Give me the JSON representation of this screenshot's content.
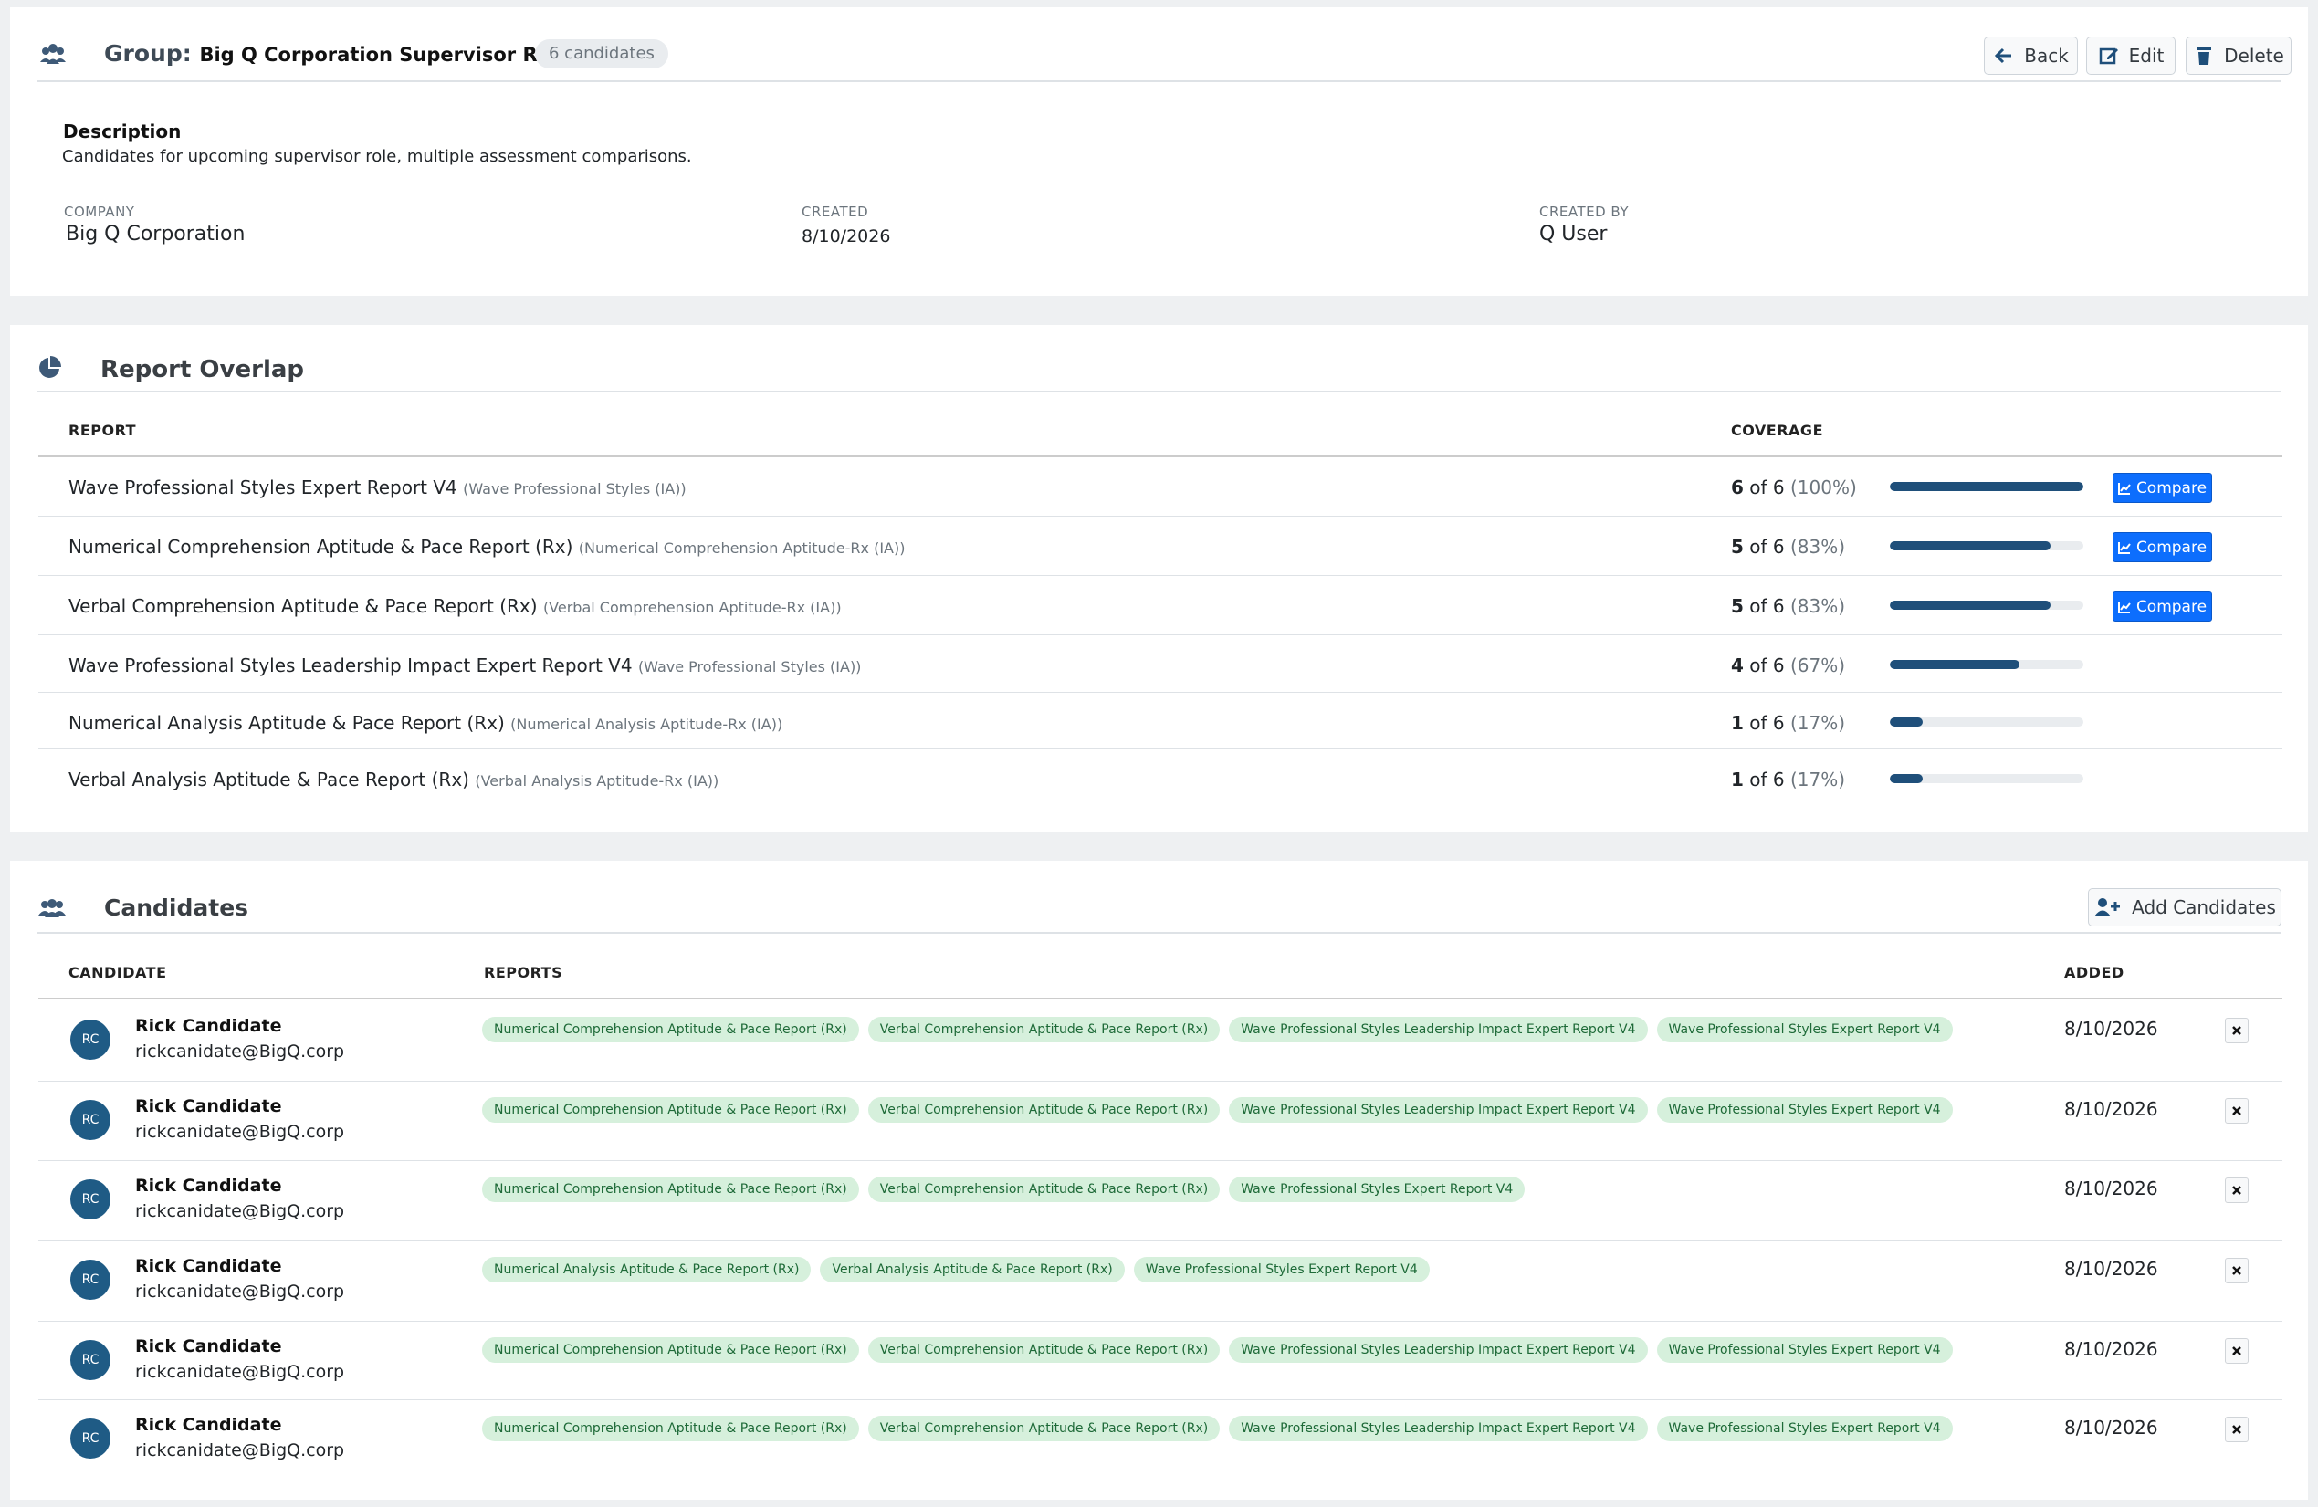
{
  "group": {
    "label": "Group:",
    "name": "Big Q Corporation Supervisor Role",
    "count_badge": "6 candidates",
    "buttons": {
      "back": "Back",
      "edit": "Edit",
      "delete": "Delete"
    },
    "description_heading": "Description",
    "description": "Candidates for upcoming supervisor role, multiple assessment comparisons.",
    "meta": {
      "company_label": "COMPANY",
      "company": "Big Q Corporation",
      "created_label": "CREATED",
      "created": "8/10/2026",
      "created_by_label": "CREATED BY",
      "created_by": "Q User"
    }
  },
  "overlap": {
    "title": "Report Overlap",
    "col_report": "REPORT",
    "col_coverage": "COVERAGE",
    "compare_label": "Compare",
    "rows": [
      {
        "name": "Wave Professional Styles Expert Report V4",
        "sub": "(Wave Professional Styles (IA))",
        "count": "6",
        "of": "of 6",
        "pct": "(100%)",
        "fraction": 1.0,
        "compare": true
      },
      {
        "name": "Numerical Comprehension Aptitude & Pace Report (Rx)",
        "sub": "(Numerical Comprehension Aptitude-Rx (IA))",
        "count": "5",
        "of": "of 6",
        "pct": "(83%)",
        "fraction": 0.83,
        "compare": true
      },
      {
        "name": "Verbal Comprehension Aptitude & Pace Report (Rx)",
        "sub": "(Verbal Comprehension Aptitude-Rx (IA))",
        "count": "5",
        "of": "of 6",
        "pct": "(83%)",
        "fraction": 0.83,
        "compare": true
      },
      {
        "name": "Wave Professional Styles Leadership Impact Expert Report V4",
        "sub": "(Wave Professional Styles (IA))",
        "count": "4",
        "of": "of 6",
        "pct": "(67%)",
        "fraction": 0.67,
        "compare": false
      },
      {
        "name": "Numerical Analysis Aptitude & Pace Report (Rx)",
        "sub": "(Numerical Analysis Aptitude-Rx (IA))",
        "count": "1",
        "of": "of 6",
        "pct": "(17%)",
        "fraction": 0.17,
        "compare": false
      },
      {
        "name": "Verbal Analysis Aptitude & Pace Report (Rx)",
        "sub": "(Verbal Analysis Aptitude-Rx (IA))",
        "count": "1",
        "of": "of 6",
        "pct": "(17%)",
        "fraction": 0.17,
        "compare": false
      }
    ]
  },
  "candidates": {
    "title": "Candidates",
    "add_label": "Add Candidates",
    "col_candidate": "CANDIDATE",
    "col_reports": "REPORTS",
    "col_added": "ADDED",
    "rows": [
      {
        "initials": "RC",
        "name": "Rick Candidate",
        "email": "rickcanidate@BigQ.corp",
        "added": "8/10/2026",
        "reports": [
          "Numerical Comprehension Aptitude & Pace Report (Rx)",
          "Verbal Comprehension Aptitude & Pace Report (Rx)",
          "Wave Professional Styles Leadership Impact Expert Report V4",
          "Wave Professional Styles Expert Report V4"
        ]
      },
      {
        "initials": "RC",
        "name": "Rick Candidate",
        "email": "rickcanidate@BigQ.corp",
        "added": "8/10/2026",
        "reports": [
          "Numerical Comprehension Aptitude & Pace Report (Rx)",
          "Verbal Comprehension Aptitude & Pace Report (Rx)",
          "Wave Professional Styles Leadership Impact Expert Report V4",
          "Wave Professional Styles Expert Report V4"
        ]
      },
      {
        "initials": "RC",
        "name": "Rick Candidate",
        "email": "rickcanidate@BigQ.corp",
        "added": "8/10/2026",
        "reports": [
          "Numerical Comprehension Aptitude & Pace Report (Rx)",
          "Verbal Comprehension Aptitude & Pace Report (Rx)",
          "Wave Professional Styles Expert Report V4"
        ]
      },
      {
        "initials": "RC",
        "name": "Rick Candidate",
        "email": "rickcanidate@BigQ.corp",
        "added": "8/10/2026",
        "reports": [
          "Numerical Analysis Aptitude & Pace Report (Rx)",
          "Verbal Analysis Aptitude & Pace Report (Rx)",
          "Wave Professional Styles Expert Report V4"
        ]
      },
      {
        "initials": "RC",
        "name": "Rick Candidate",
        "email": "rickcanidate@BigQ.corp",
        "added": "8/10/2026",
        "reports": [
          "Numerical Comprehension Aptitude & Pace Report (Rx)",
          "Verbal Comprehension Aptitude & Pace Report (Rx)",
          "Wave Professional Styles Leadership Impact Expert Report V4",
          "Wave Professional Styles Expert Report V4"
        ]
      },
      {
        "initials": "RC",
        "name": "Rick Candidate",
        "email": "rickcanidate@BigQ.corp",
        "added": "8/10/2026",
        "reports": [
          "Numerical Comprehension Aptitude & Pace Report (Rx)",
          "Verbal Comprehension Aptitude & Pace Report (Rx)",
          "Wave Professional Styles Leadership Impact Expert Report V4",
          "Wave Professional Styles Expert Report V4"
        ]
      }
    ]
  },
  "colors": {
    "accent": "#1f4f7a",
    "primary_button": "#0d6efd",
    "tag_bg": "#d6f0dc",
    "tag_text": "#1e6a38",
    "avatar": "#1f5b85"
  }
}
